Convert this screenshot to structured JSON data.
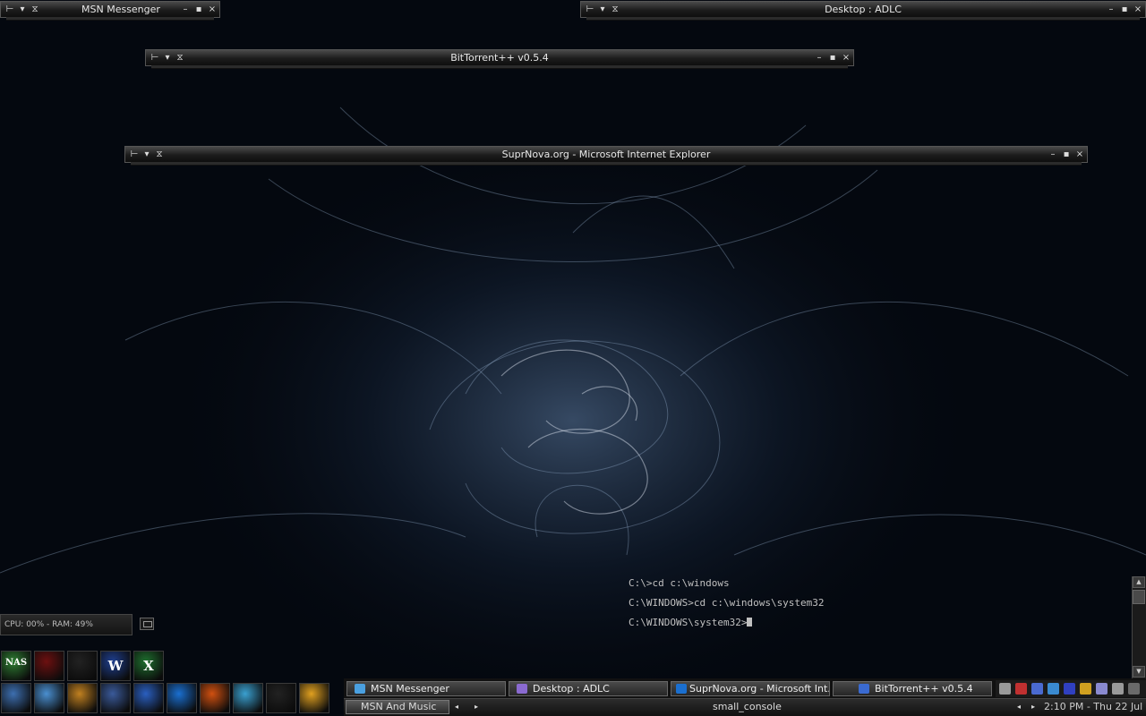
{
  "windows": [
    {
      "title": "MSN Messenger"
    },
    {
      "title": "Desktop : ADLC"
    },
    {
      "title": "BitTorrent++ v0.5.4"
    },
    {
      "title": "SuprNova.org - Microsoft Internet Explorer"
    }
  ],
  "console": {
    "lines": [
      "C:\\>cd c:\\windows",
      "C:\\WINDOWS>cd c:\\windows\\system32",
      "C:\\WINDOWS\\system32>"
    ]
  },
  "sysmon": {
    "text": "CPU: 00% - RAM: 49%"
  },
  "quicklaunch": {
    "row1": [
      {
        "icon": "nas-icon",
        "label": "NAS",
        "color": "#2e7d32"
      },
      {
        "icon": "wifi-tower-icon",
        "color": "#6d1010"
      },
      {
        "icon": "blank-app-icon",
        "color": "#222222"
      },
      {
        "icon": "word-icon",
        "label": "W",
        "color": "#1f3f8f"
      },
      {
        "icon": "excel-icon",
        "label": "X",
        "color": "#1f6f2f"
      }
    ],
    "row2": [
      {
        "icon": "computer-icon",
        "color": "#3d6fb0"
      },
      {
        "icon": "notepad-icon",
        "color": "#4a8fd0"
      },
      {
        "icon": "lightning-app-icon",
        "color": "#c08020"
      },
      {
        "icon": "network-app-icon",
        "color": "#3a5a9a"
      },
      {
        "icon": "blue-disc-icon",
        "color": "#2a5fc0"
      },
      {
        "icon": "internet-explorer-icon",
        "color": "#1a6fd0"
      },
      {
        "icon": "firefox-icon",
        "color": "#d05010"
      },
      {
        "icon": "msn-people-icon",
        "color": "#3aa0d0"
      },
      {
        "icon": "console-icon",
        "color": "#222222"
      },
      {
        "icon": "favorites-star-icon",
        "color": "#e0a020"
      }
    ]
  },
  "taskbar": {
    "tasks": [
      {
        "label": "MSN Messenger",
        "icon": "msn-icon",
        "color": "#4aa0e0"
      },
      {
        "label": "Desktop : ADLC",
        "icon": "desktop-icon",
        "color": "#8a6ad0"
      },
      {
        "label": "SuprNova.org - Microsoft Int...",
        "icon": "ie-icon",
        "color": "#1a6fd0"
      },
      {
        "label": "BitTorrent++ v0.5.4",
        "icon": "bittorrent-icon",
        "color": "#3a6ad0"
      }
    ],
    "tray": [
      "#9a9a9a",
      "#c03030",
      "#4a6ad0",
      "#3a8ad0",
      "#3040c0",
      "#d0a020",
      "#8a8ad0",
      "#9a9a9a",
      "#6a6a6a"
    ]
  },
  "bottombar": {
    "left_label": "MSN And Music",
    "center_label": "small_console",
    "clock": "2:10 PM - Thu 22 Jul"
  }
}
